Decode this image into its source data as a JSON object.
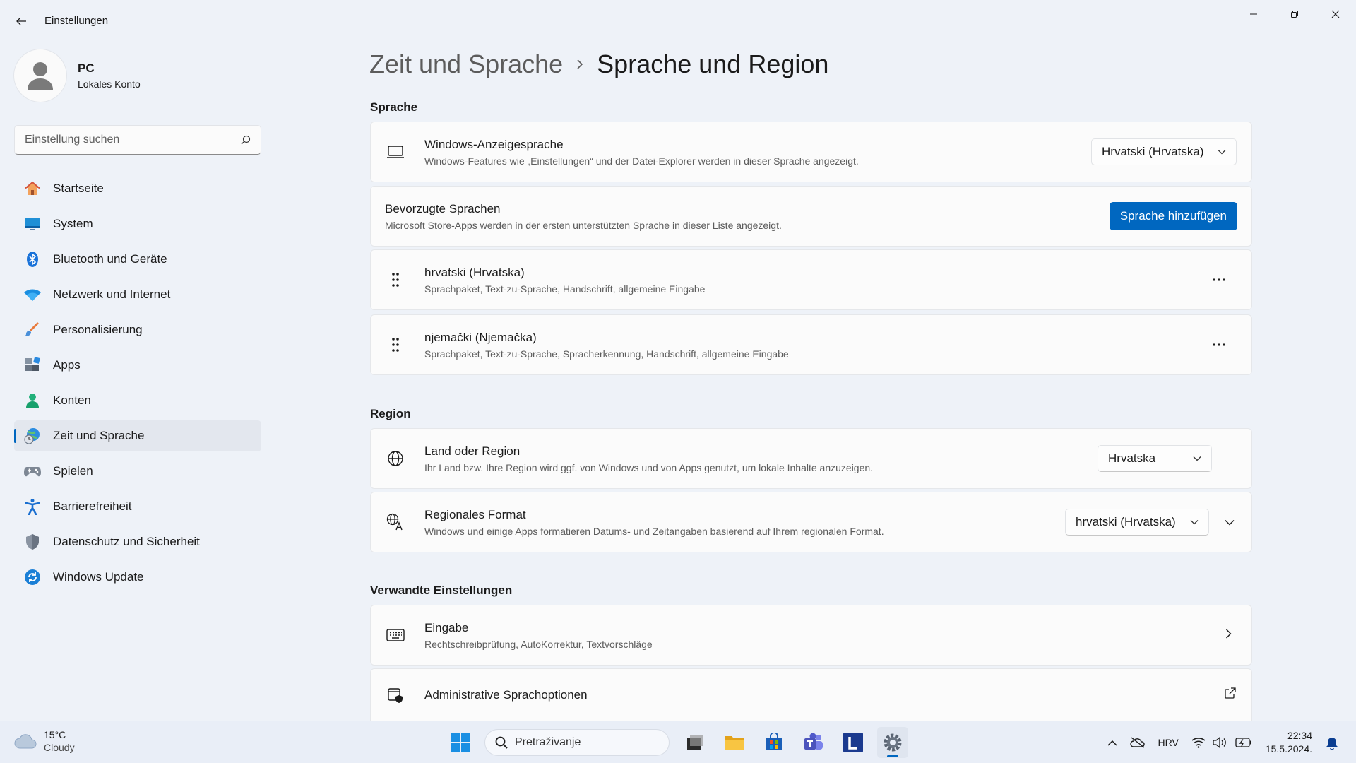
{
  "app": {
    "title": "Einstellungen"
  },
  "profile": {
    "name": "PC",
    "account": "Lokales Konto"
  },
  "search": {
    "placeholder": "Einstellung suchen"
  },
  "nav": {
    "items": [
      {
        "label": "Startseite",
        "icon": "home-icon"
      },
      {
        "label": "System",
        "icon": "monitor-icon"
      },
      {
        "label": "Bluetooth und Geräte",
        "icon": "bluetooth-icon"
      },
      {
        "label": "Netzwerk und Internet",
        "icon": "wifi-icon"
      },
      {
        "label": "Personalisierung",
        "icon": "brush-icon"
      },
      {
        "label": "Apps",
        "icon": "apps-icon"
      },
      {
        "label": "Konten",
        "icon": "person-icon"
      },
      {
        "label": "Zeit und Sprache",
        "icon": "globe-clock-icon"
      },
      {
        "label": "Spielen",
        "icon": "gamepad-icon"
      },
      {
        "label": "Barrierefreiheit",
        "icon": "accessibility-icon"
      },
      {
        "label": "Datenschutz und Sicherheit",
        "icon": "shield-icon"
      },
      {
        "label": "Windows Update",
        "icon": "update-icon"
      }
    ]
  },
  "breadcrumb": {
    "parent": "Zeit und Sprache",
    "current": "Sprache und Region"
  },
  "sprache": {
    "section_title": "Sprache",
    "display_language": {
      "title": "Windows-Anzeigesprache",
      "desc": "Windows-Features wie „Einstellungen“ und der Datei-Explorer werden in dieser Sprache angezeigt.",
      "value": "Hrvatski (Hrvatska)"
    },
    "preferred": {
      "title": "Bevorzugte Sprachen",
      "desc": "Microsoft Store-Apps werden in der ersten unterstützten Sprache in dieser Liste angezeigt.",
      "button": "Sprache hinzufügen"
    },
    "languages": [
      {
        "name": "hrvatski (Hrvatska)",
        "features": "Sprachpaket, Text-zu-Sprache, Handschrift, allgemeine Eingabe"
      },
      {
        "name": "njemački (Njemačka)",
        "features": "Sprachpaket, Text-zu-Sprache, Spracherkennung, Handschrift, allgemeine Eingabe"
      }
    ]
  },
  "region": {
    "section_title": "Region",
    "country": {
      "title": "Land oder Region",
      "desc": "Ihr Land bzw. Ihre Region wird ggf. von Windows und von Apps genutzt, um lokale Inhalte anzuzeigen.",
      "value": "Hrvatska"
    },
    "format": {
      "title": "Regionales Format",
      "desc": "Windows und einige Apps formatieren Datums- und Zeitangaben basierend auf Ihrem regionalen Format.",
      "value": "hrvatski (Hrvatska)"
    }
  },
  "related": {
    "section_title": "Verwandte Einstellungen",
    "typing": {
      "title": "Eingabe",
      "desc": "Rechtschreibprüfung, AutoKorrektur, Textvorschläge"
    },
    "admin": {
      "title": "Administrative Sprachoptionen"
    }
  },
  "taskbar": {
    "weather_temp": "15°C",
    "weather_desc": "Cloudy",
    "search_placeholder": "Pretraživanje",
    "lang": "HRV",
    "time": "22:34",
    "date": "15.5.2024."
  },
  "colors": {
    "accent": "#0067c0",
    "background": "#eef2f8",
    "card": "#fbfbfb"
  }
}
